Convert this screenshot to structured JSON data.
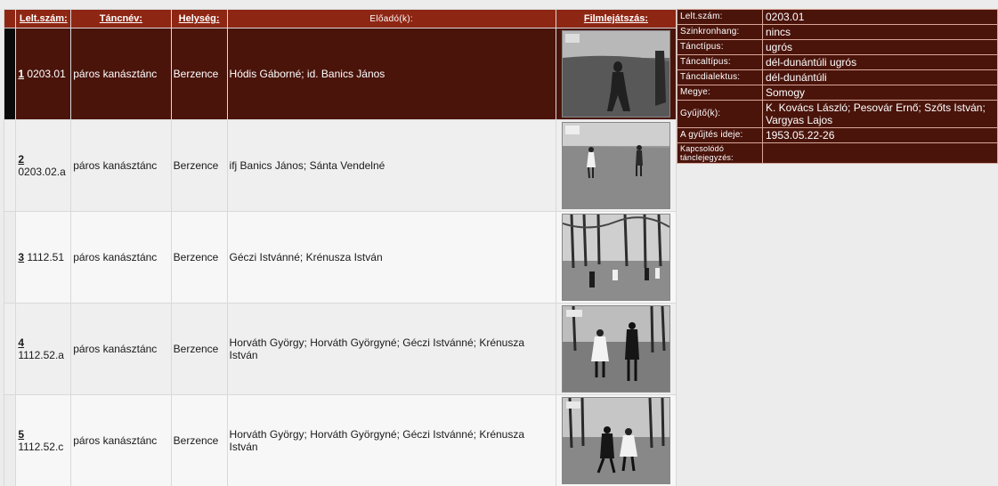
{
  "columns": {
    "leltszam": "Lelt.szám:",
    "tancnev": "Táncnév:",
    "helyseg": "Helység:",
    "eloado": "Előadó(k):",
    "film": "Filmlejátszás:"
  },
  "rows": [
    {
      "num": "1",
      "id": "0203.01",
      "name": "páros kanásztánc",
      "place": "Berzence",
      "performers": "Hódis Gáborné; id. Banics János",
      "selected": true
    },
    {
      "num": "2",
      "id": "0203.02.a",
      "name": "páros kanásztánc",
      "place": "Berzence",
      "performers": "ifj Banics János; Sánta Vendelné",
      "selected": false
    },
    {
      "num": "3",
      "id": "1112.51",
      "name": "páros kanásztánc",
      "place": "Berzence",
      "performers": "Géczi Istvánné; Krénusza István",
      "selected": false
    },
    {
      "num": "4",
      "id": "1112.52.a",
      "name": "páros kanásztánc",
      "place": "Berzence",
      "performers": "Horváth György; Horváth Györgyné; Géczi Istvánné; Krénusza István",
      "selected": false
    },
    {
      "num": "5",
      "id": "1112.52.c",
      "name": "páros kanásztánc",
      "place": "Berzence",
      "performers": "Horváth György; Horváth Györgyné; Géczi Istvánné; Krénusza István",
      "selected": false
    }
  ],
  "detail": [
    {
      "label": "Lelt.szám:",
      "value": "0203.01"
    },
    {
      "label": "Szinkronhang:",
      "value": "nincs"
    },
    {
      "label": "Tánctípus:",
      "value": "ugrós"
    },
    {
      "label": "Táncaltípus:",
      "value": "dél-dunántúli ugrós"
    },
    {
      "label": "Táncdialektus:",
      "value": "dél-dunántúli"
    },
    {
      "label": "Megye:",
      "value": "Somogy"
    },
    {
      "label": "Gyűjtő(k):",
      "value": "K. Kovács László; Pesovár Ernő; Szőts István; Vargyas Lajos"
    },
    {
      "label": "A gyűjtés ideje:",
      "value": "1953.05.22-26"
    },
    {
      "label": "Kapcsolódó tánclejegyzés:",
      "value": ""
    }
  ],
  "colors": {
    "header_bg": "#8e2614",
    "selected_bg": "#4a140b",
    "detail_bg": "#4a140b"
  },
  "icons": {
    "thumbnail": "film-still-thumbnail"
  }
}
